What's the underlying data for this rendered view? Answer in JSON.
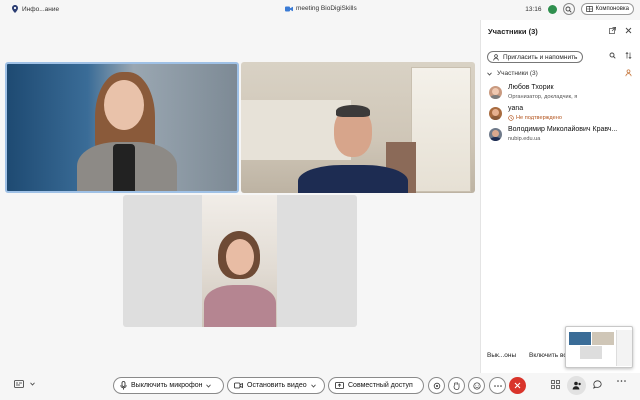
{
  "topbar": {
    "left_label": "Инфо...ание",
    "meeting_title": "meeting BioDigiSkills",
    "time": "13:16",
    "layout_label": "Компоновка"
  },
  "panel": {
    "title": "Участники (3)",
    "invite_label": "Пригласить и напомнить",
    "group_label": "Участники (3)",
    "participants": [
      {
        "name": "Любов Тхорик",
        "subtitle": "Организатор, докладчик, я"
      },
      {
        "name": "yana",
        "subtitle": "Не подтверждено"
      },
      {
        "name": "Володимир Миколайович Кравч...",
        "subtitle": "nubip.edu.ua"
      }
    ],
    "footer_left": "Вык...оны",
    "footer_right": "Включить вс"
  },
  "controls": {
    "mic_label": "Выключить микрофон",
    "video_label": "Остановить видео",
    "share_label": "Совместный доступ"
  },
  "colors": {
    "end_call": "#d9342b",
    "status_green": "#2f8f4e",
    "warning": "#b3541e",
    "tile_active_border": "#9fc1e6"
  }
}
